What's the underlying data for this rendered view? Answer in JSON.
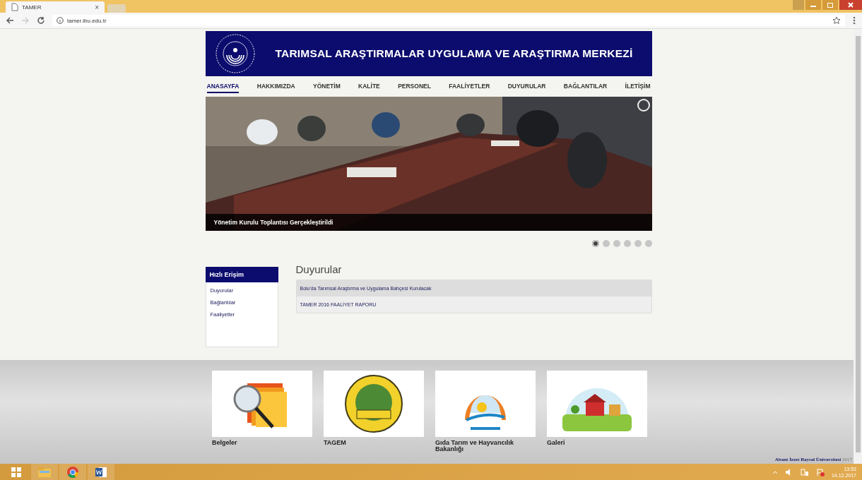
{
  "browser": {
    "tab_title": "TAMER",
    "tab_close": "×",
    "url": "tamer.ibu.edu.tr"
  },
  "header": {
    "title": "TARIMSAL ARAŞTIRMALAR UYGULAMA VE ARAŞTIRMA MERKEZİ"
  },
  "nav": [
    {
      "label": "ANASAYFA",
      "selected": true
    },
    {
      "label": "HAKKIMIZDA",
      "selected": false
    },
    {
      "label": "YÖNETİM",
      "selected": false
    },
    {
      "label": "KALİTE",
      "selected": false
    },
    {
      "label": "PERSONEL",
      "selected": false
    },
    {
      "label": "FAALİYETLER",
      "selected": false
    },
    {
      "label": "DUYURULAR",
      "selected": false
    },
    {
      "label": "BAĞLANTILAR",
      "selected": false
    },
    {
      "label": "İLETİŞİM",
      "selected": false
    }
  ],
  "slider": {
    "caption": "Yönetim Kurulu Toplantısı Gerçekleştirildi",
    "dots": [
      {
        "selected": true
      },
      {
        "selected": false
      },
      {
        "selected": false
      },
      {
        "selected": false
      },
      {
        "selected": false
      },
      {
        "selected": false
      }
    ]
  },
  "quick_access": {
    "title": "Hızlı Erişim",
    "items": [
      "Duyurular",
      "Bağlantılar",
      "Faaliyetler"
    ]
  },
  "announcements": {
    "title": "Duyurular",
    "items": [
      {
        "text": "Bolu'da Tarımsal Araştırma ve Uygulama Bahçesi Kurulacak",
        "highlighted": true
      },
      {
        "text": "TAMER 2016 FAALİYET RAPORU",
        "highlighted": false
      }
    ]
  },
  "tiles": [
    {
      "label": "Belgeler",
      "kind": "folders"
    },
    {
      "label": "TAGEM",
      "kind": "seal"
    },
    {
      "label": "Gıda Tarım ve Hayvancılık Bakanlığı",
      "kind": "sun"
    },
    {
      "label": "Galeri",
      "kind": "farm"
    }
  ],
  "footer": {
    "text": "**Abant İzzet Baysal Üniversitesi** 2017"
  },
  "taskbar": {
    "time": "13:53",
    "date": "14.12.2017"
  }
}
